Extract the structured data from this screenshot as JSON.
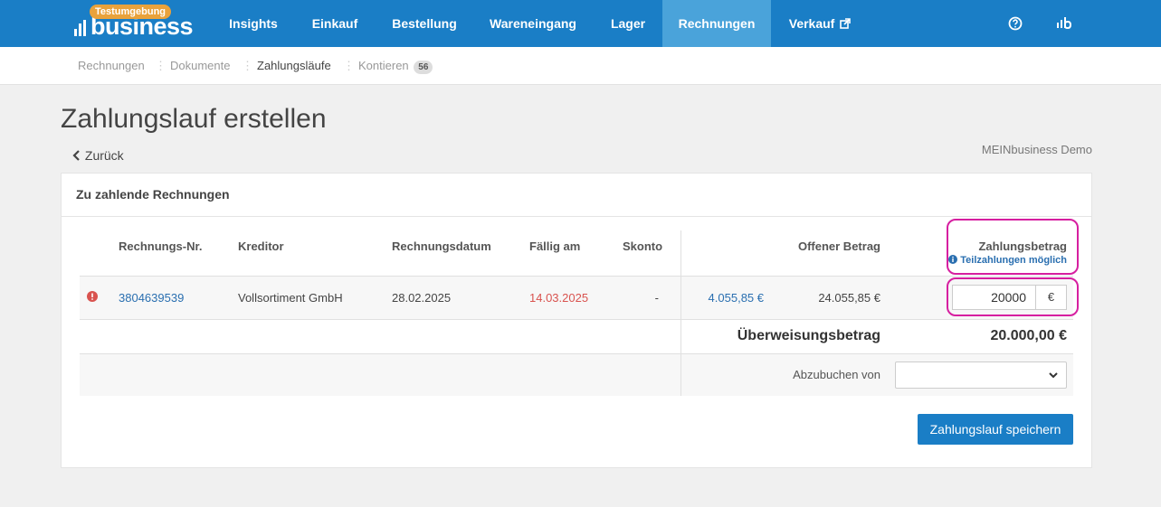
{
  "brand": {
    "logo_text": "business",
    "env_badge": "Testumgebung"
  },
  "nav": {
    "items": [
      {
        "label": "Insights"
      },
      {
        "label": "Einkauf"
      },
      {
        "label": "Bestellung"
      },
      {
        "label": "Wareneingang"
      },
      {
        "label": "Lager"
      },
      {
        "label": "Rechnungen"
      },
      {
        "label": "Verkauf"
      }
    ],
    "active": "Rechnungen",
    "icons": [
      "help-circle-icon",
      "stats-logo-icon",
      "external-link-icon"
    ]
  },
  "subnav": {
    "items": [
      {
        "label": "Rechnungen"
      },
      {
        "label": "Dokumente"
      },
      {
        "label": "Zahlungsläufe"
      },
      {
        "label": "Kontieren",
        "count": "56"
      }
    ],
    "active": "Zahlungsläufe"
  },
  "page": {
    "title": "Zahlungslauf erstellen",
    "back_label": "Zurück",
    "tenant": "MEINbusiness Demo"
  },
  "card": {
    "title": "Zu zahlende Rechnungen",
    "columns": {
      "rechnungs_nr": "Rechnungs-Nr.",
      "kreditor": "Kreditor",
      "rechnungsdatum": "Rechnungsdatum",
      "faellig_am": "Fällig am",
      "skonto": "Skonto",
      "offener_betrag": "Offener Betrag",
      "zahlungsbetrag": "Zahlungsbetrag",
      "teilzahlungen_hint": "Teilzahlungen möglich"
    },
    "rows": [
      {
        "rechnungs_nr": "3804639539",
        "kreditor": "Vollsortiment GmbH",
        "rechnungsdatum": "28.02.2025",
        "faellig_am": "14.03.2025",
        "skonto": "-",
        "offen_link": "4.055,85 €",
        "offener_betrag": "24.055,85 €",
        "zahlungsbetrag_value": "20000",
        "currency": "€"
      }
    ],
    "ueberweisung_label": "Überweisungsbetrag",
    "ueberweisung_value": "20.000,00 €",
    "abzubuchen_label": "Abzubuchen von",
    "abzubuchen_value": "",
    "save_button": "Zahlungslauf speichern"
  },
  "colors": {
    "primary": "#1a7ec6",
    "nav_active": "#4aa3da",
    "badge_orange": "#e9a23b",
    "overdue_red": "#d9534f",
    "highlight_magenta": "#d61fa0"
  }
}
